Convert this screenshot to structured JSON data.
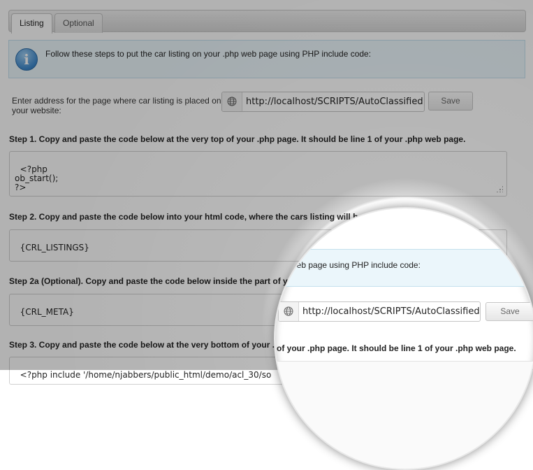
{
  "tabs": [
    {
      "label": "Listing",
      "active": true
    },
    {
      "label": "Optional",
      "active": false
    }
  ],
  "info": {
    "text": "Follow these steps to put the car listing on your .php web page using PHP include code:",
    "icon": "info-icon"
  },
  "address": {
    "label": "Enter address for the page where car listing is placed on your website:",
    "value": "http://localhost/SCRIPTS/AutoClassified",
    "save_label": "Save"
  },
  "steps": [
    {
      "label": "Step 1. Copy and paste the code below at the very top of your .php page. It should be line 1 of your .php web page.",
      "code": "<?php\nob_start();\n?>"
    },
    {
      "label": "Step 2. Copy and paste the code below into your html code, where the cars listing will b",
      "code": "{CRL_LISTINGS}"
    },
    {
      "label": "Step 2a (Optional). Copy and paste the code below inside the part of yo",
      "code": "{CRL_META}"
    },
    {
      "label": "Step 3. Copy and paste the code below at the very bottom of your .pl",
      "code": "<?php include '/home/njabbers/public_html/demo/acl_30/so"
    }
  ],
  "magnifier": {
    "info_text": "p web page using PHP include code:",
    "url_value": "http://localhost/SCRIPTS/AutoClassified",
    "save_label": "Save",
    "step_text": "of your .php page. It should be line 1 of your .php web page."
  },
  "colors": {
    "info_bg": "#ebf6fb",
    "info_border": "#c4e0ed",
    "tabbar_bg": "#dcdcdc"
  }
}
